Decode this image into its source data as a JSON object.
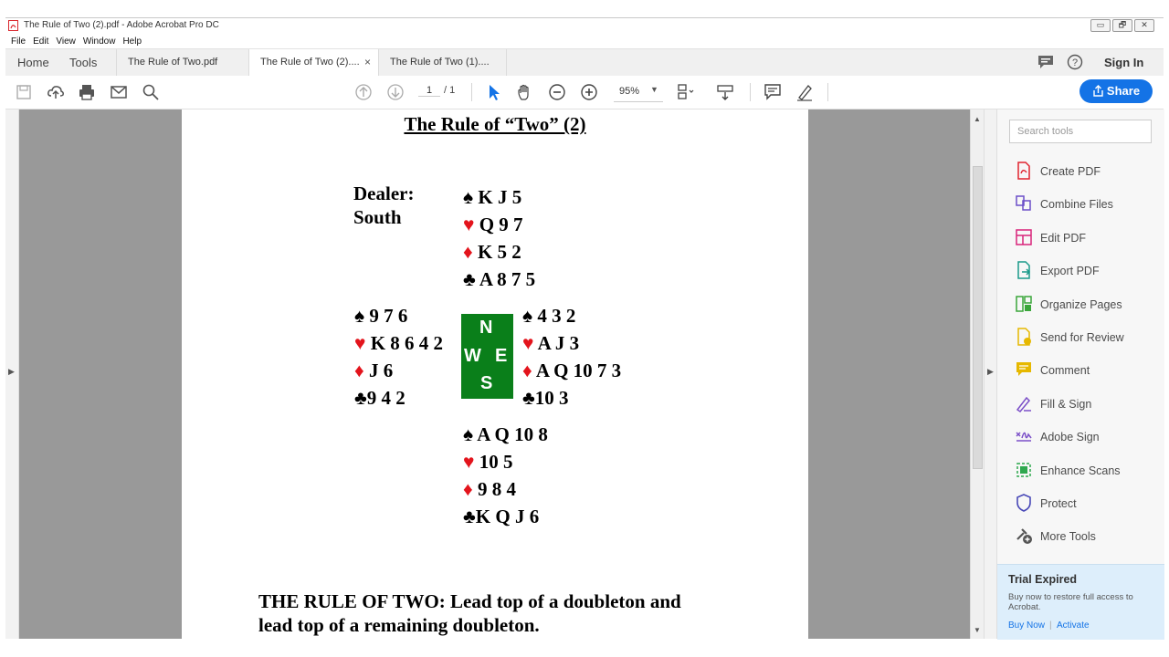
{
  "window": {
    "title": "The Rule of Two (2).pdf - Adobe Acrobat Pro DC",
    "controls": [
      "▭",
      "🗗",
      "✕"
    ]
  },
  "menu": [
    "File",
    "Edit",
    "View",
    "Window",
    "Help"
  ],
  "nav_tabs": {
    "home": "Home",
    "tools": "Tools"
  },
  "doc_tabs": [
    {
      "label": "The Rule of Two.pdf",
      "active": false
    },
    {
      "label": "The Rule of Two (2)....",
      "active": true,
      "close": "×"
    },
    {
      "label": "The Rule of Two (1)....",
      "active": false
    }
  ],
  "header_right": {
    "sign_in": "Sign In"
  },
  "toolbar": {
    "page_current": "1",
    "page_total": "/ 1",
    "zoom": "95%",
    "share_label": "Share"
  },
  "document": {
    "title": "The Rule of “Two” (2)",
    "dealer_label": "Dealer:",
    "dealer_value": "South",
    "north": {
      "spades": "K J 5",
      "hearts": "Q 9 7",
      "diamonds": "K 5 2",
      "clubs": "A 8 7 5"
    },
    "west": {
      "spades": "9 7 6",
      "hearts": "K 8 6 4 2",
      "diamonds": "J 6",
      "clubs": "9 4 2"
    },
    "east": {
      "spades": "4 3 2",
      "hearts": "A J 3",
      "diamonds": "A Q 10 7 3",
      "clubs": "10 3"
    },
    "south": {
      "spades": "A Q 10 8",
      "hearts": "10 5",
      "diamonds": "9 8 4",
      "clubs": "K Q J 6"
    },
    "compass": {
      "n": "N",
      "w": "W",
      "e": "E",
      "s": "S"
    },
    "rule_line1": "THE RULE OF TWO: Lead top of a doubleton and",
    "rule_line2": "lead top of a remaining doubleton."
  },
  "suits": {
    "spade": "♠",
    "heart": "♥",
    "diamond": "♦",
    "club": "♣"
  },
  "tools_panel": {
    "search_placeholder": "Search tools",
    "items": [
      {
        "label": "Create PDF",
        "icon": "create-pdf-icon",
        "color": "#e0242f"
      },
      {
        "label": "Combine Files",
        "icon": "combine-files-icon",
        "color": "#6b4fc8"
      },
      {
        "label": "Edit PDF",
        "icon": "edit-pdf-icon",
        "color": "#d9247a"
      },
      {
        "label": "Export PDF",
        "icon": "export-pdf-icon",
        "color": "#1a9a8a"
      },
      {
        "label": "Organize Pages",
        "icon": "organize-pages-icon",
        "color": "#3aa63a"
      },
      {
        "label": "Send for Review",
        "icon": "send-for-review-icon",
        "color": "#e6b800"
      },
      {
        "label": "Comment",
        "icon": "comment-icon",
        "color": "#e6b800"
      },
      {
        "label": "Fill & Sign",
        "icon": "fill-sign-icon",
        "color": "#7b4fc8"
      },
      {
        "label": "Adobe Sign",
        "icon": "adobe-sign-icon",
        "color": "#7b4fc8"
      },
      {
        "label": "Enhance Scans",
        "icon": "enhance-scans-icon",
        "color": "#2fa84f"
      },
      {
        "label": "Protect",
        "icon": "protect-icon",
        "color": "#4a4ab8"
      },
      {
        "label": "More Tools",
        "icon": "more-tools-icon",
        "color": "#555555"
      }
    ],
    "trial": {
      "title": "Trial Expired",
      "text": "Buy now to restore full access to Acrobat.",
      "buy_now": "Buy Now",
      "divider": "|",
      "activate": "Activate"
    }
  },
  "colors": {
    "accent": "#1473e6",
    "compass_green": "#0a7f1a",
    "red_suit": "#e3141c",
    "doc_background": "#999999"
  }
}
